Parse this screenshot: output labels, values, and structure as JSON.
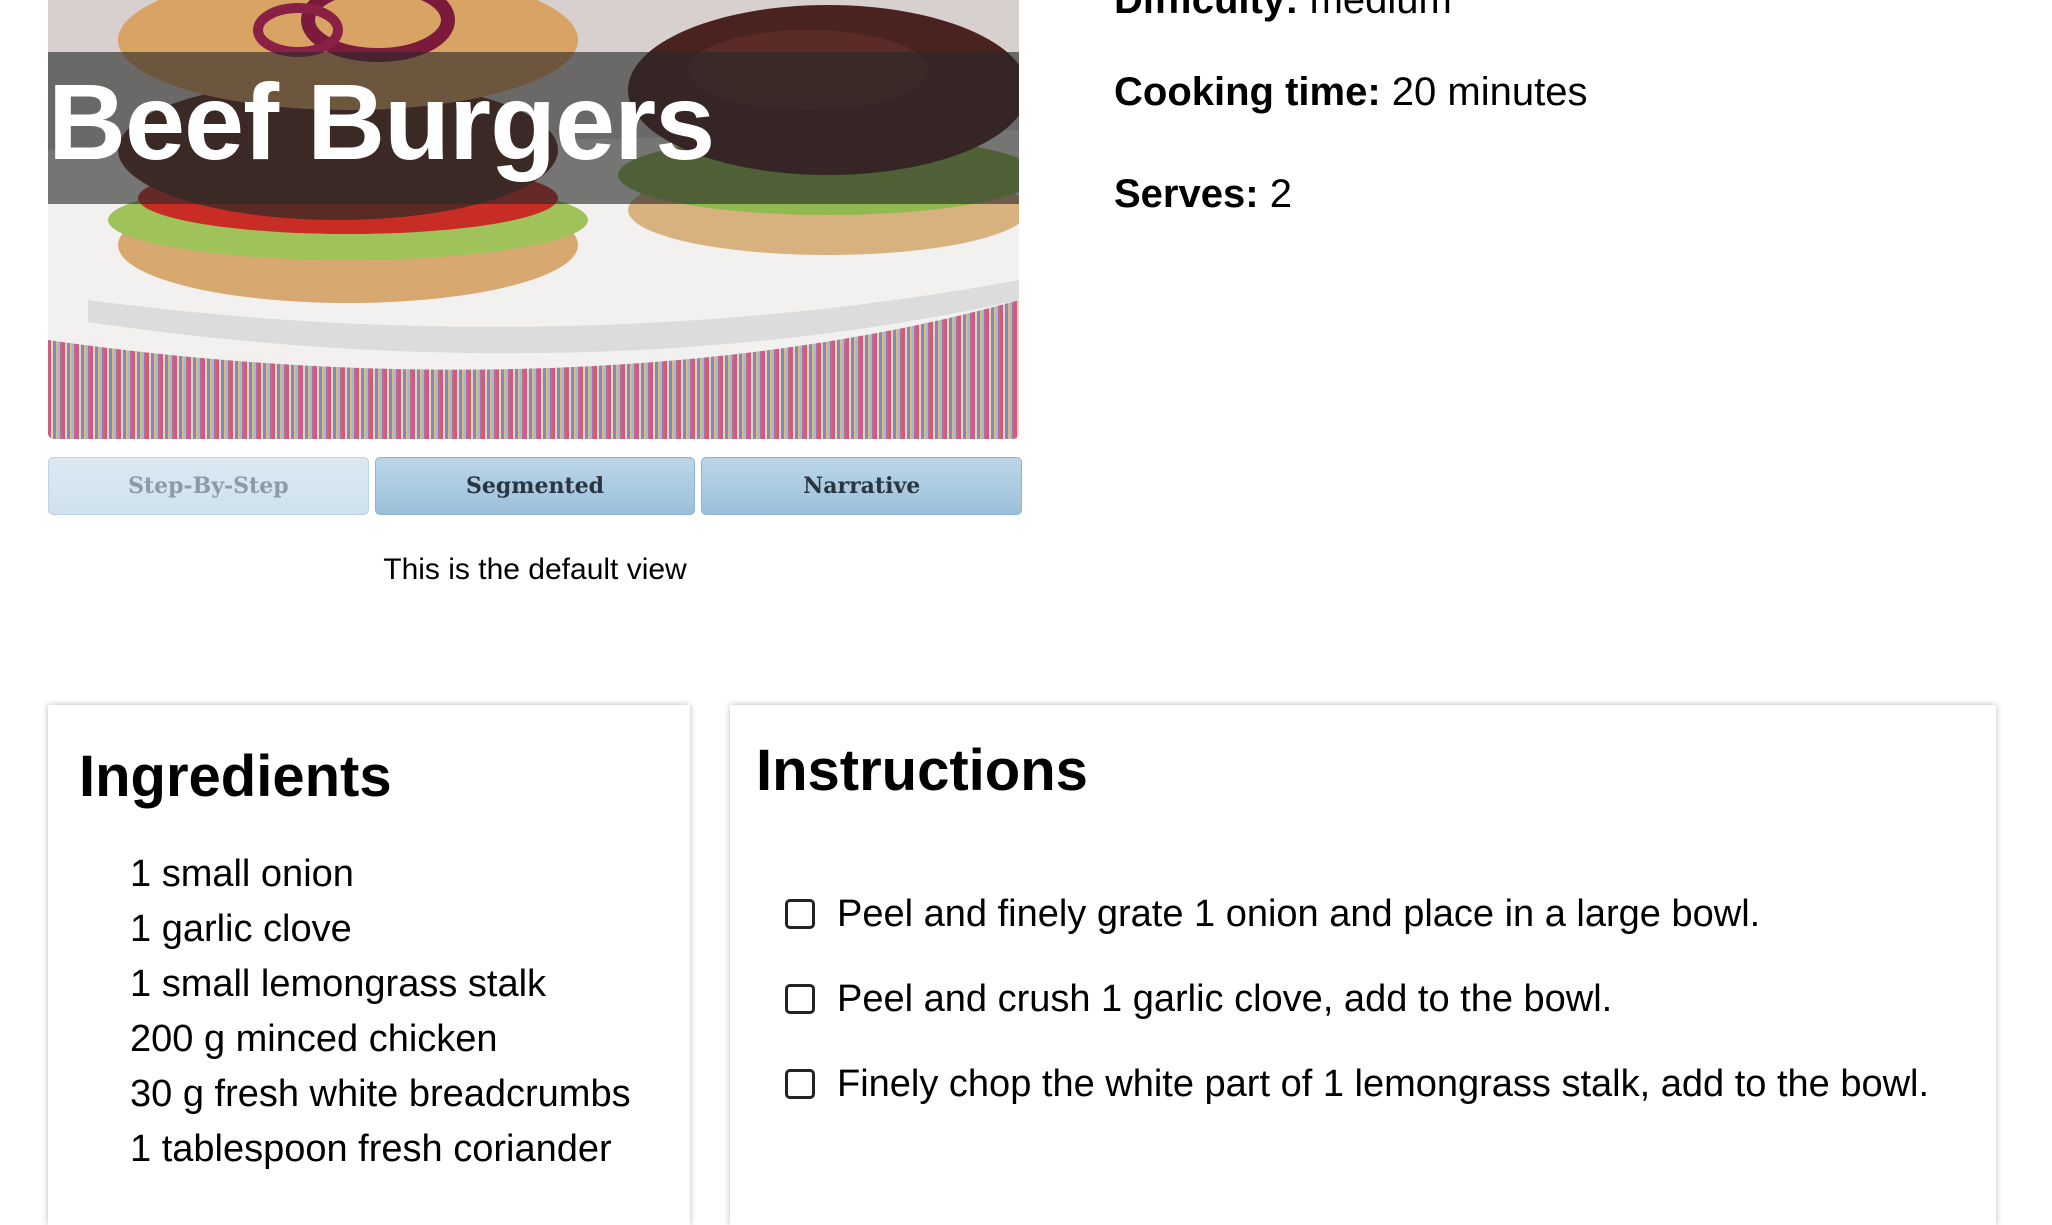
{
  "recipe": {
    "title": "Beef Burgers",
    "difficulty_label": "Difficulty:",
    "difficulty_value": "medium",
    "cooking_time_label": "Cooking time:",
    "cooking_time_value": "20 minutes",
    "serves_label": "Serves:",
    "serves_value": "2"
  },
  "view_toggle": {
    "buttons": [
      {
        "label": "Step-By-Step",
        "active": false
      },
      {
        "label": "Segmented",
        "active": true
      },
      {
        "label": "Narrative",
        "active": true
      }
    ],
    "caption": "This is the default view"
  },
  "ingredients": {
    "heading": "Ingredients",
    "items": [
      "1 small onion",
      "1 garlic clove",
      "1 small lemongrass stalk",
      "200 g minced chicken",
      "30 g fresh white breadcrumbs",
      "1 tablespoon fresh coriander"
    ]
  },
  "instructions": {
    "heading": "Instructions",
    "steps": [
      "Peel and finely grate 1 onion and place in a large bowl.",
      "Peel and crush 1 garlic clove, add to the bowl.",
      "Finely chop the white part of 1 lemongrass stalk, add to the bowl."
    ]
  },
  "colors": {
    "button_active": "#9cc0da",
    "button_inactive": "#cfe1ee",
    "title_band": "#282828"
  }
}
